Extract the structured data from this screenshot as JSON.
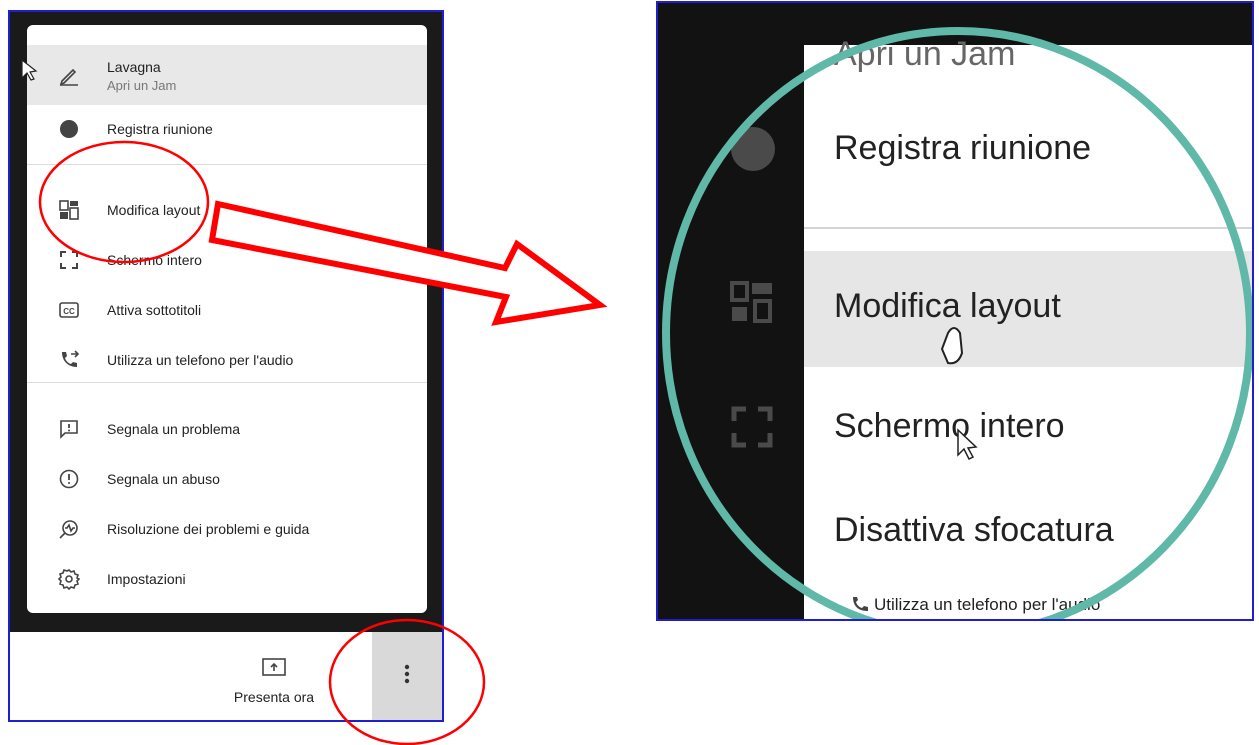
{
  "menu": {
    "items": [
      {
        "label": "Lavagna",
        "sublabel": "Apri un Jam",
        "icon": "pencil-icon"
      },
      {
        "label": "Registra riunione",
        "icon": "record-dot-icon"
      },
      {
        "label": "Modifica layout",
        "icon": "layout-icon"
      },
      {
        "label": "Schermo intero",
        "icon": "fullscreen-icon"
      },
      {
        "label": "Attiva sottotitoli",
        "icon": "closed-captions-icon"
      },
      {
        "label": "Utilizza un telefono per l'audio",
        "icon": "phone-forward-icon"
      },
      {
        "label": "Segnala un problema",
        "icon": "feedback-icon"
      },
      {
        "label": "Segnala un abuso",
        "icon": "report-icon"
      },
      {
        "label": "Risoluzione dei problemi e guida",
        "icon": "troubleshoot-icon"
      },
      {
        "label": "Impostazioni",
        "icon": "gear-icon"
      }
    ]
  },
  "bottombar": {
    "present_label": "Presenta ora",
    "more_icon": "more-vert-icon"
  },
  "zoom": {
    "items": [
      {
        "label": "Apri un Jam"
      },
      {
        "label": "Registra riunione"
      },
      {
        "label": "Modifica layout"
      },
      {
        "label": "Schermo intero"
      },
      {
        "label": "Disattiva sfocatura"
      },
      {
        "label": "Utilizza un telefono per l'audio"
      }
    ]
  },
  "colors": {
    "annotation_red": "#ff0000",
    "panel_border": "#1f1fcf",
    "magnifier_ring": "#5fb8a8"
  }
}
